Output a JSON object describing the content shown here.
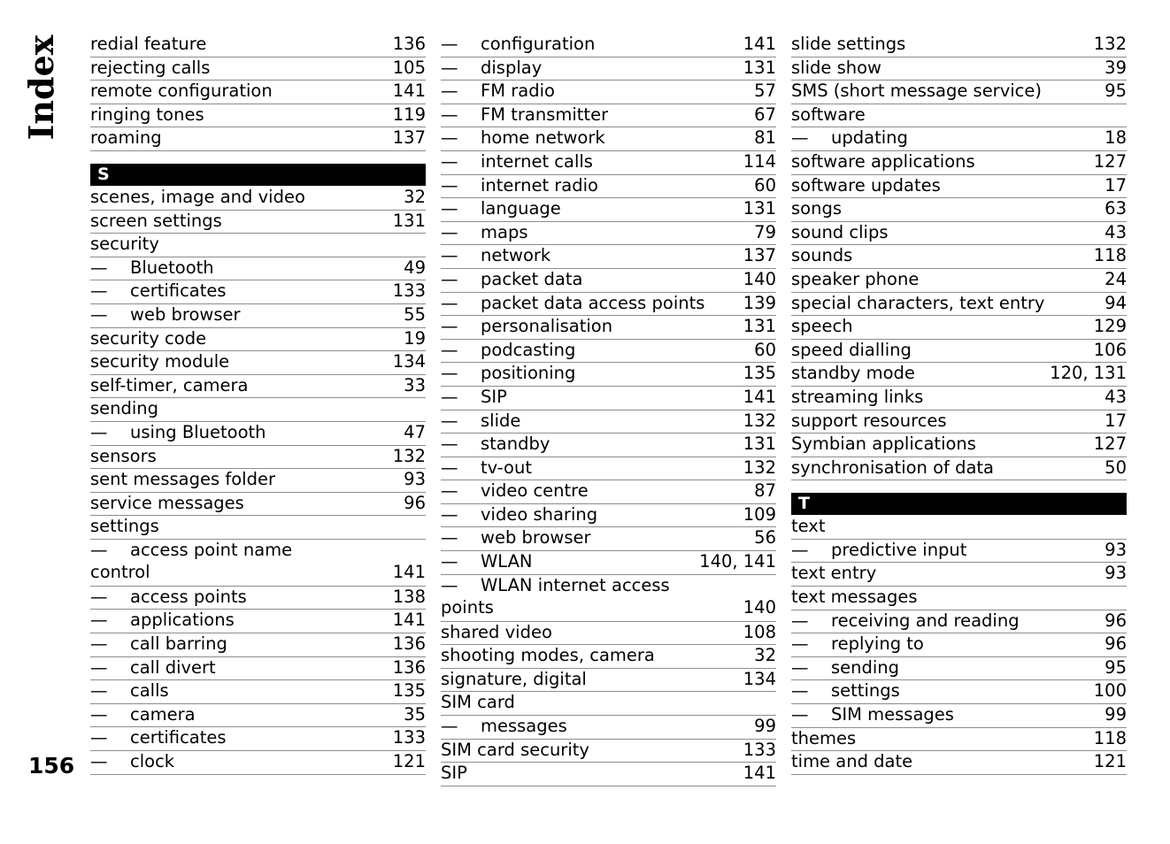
{
  "page": {
    "side_label": "Index",
    "folio": "156"
  },
  "columns": [
    {
      "id": "column-1",
      "blocks": [
        {
          "type": "entries",
          "rows": [
            {
              "term": "redial feature",
              "page": "136",
              "level": 1
            },
            {
              "term": "rejecting calls",
              "page": "105",
              "level": 1
            },
            {
              "term": "remote configuration",
              "page": "141",
              "level": 1
            },
            {
              "term": "ringing tones",
              "page": "119",
              "level": 1
            },
            {
              "term": "roaming",
              "page": "137",
              "level": 1
            }
          ]
        },
        {
          "type": "spacer"
        },
        {
          "type": "letter",
          "label": "S"
        },
        {
          "type": "entries",
          "rows": [
            {
              "term": "scenes, image and video",
              "page": "32",
              "level": 1
            },
            {
              "term": "screen settings",
              "page": "131",
              "level": 1
            },
            {
              "term": "security",
              "page": "",
              "level": 1
            },
            {
              "term": "Bluetooth",
              "page": "49",
              "level": 2
            },
            {
              "term": "certificates",
              "page": "133",
              "level": 2
            },
            {
              "term": "web browser",
              "page": "55",
              "level": 2
            },
            {
              "term": "security code",
              "page": "19",
              "level": 1
            },
            {
              "term": "security module",
              "page": "134",
              "level": 1
            },
            {
              "term": "self-timer, camera",
              "page": "33",
              "level": 1
            },
            {
              "term": "sending",
              "page": "",
              "level": 1
            },
            {
              "term": "using Bluetooth",
              "page": "47",
              "level": 2
            },
            {
              "term": "sensors",
              "page": "132",
              "level": 1
            },
            {
              "term": "sent messages folder",
              "page": "93",
              "level": 1
            },
            {
              "term": "service messages",
              "page": "96",
              "level": 1
            },
            {
              "term": "settings",
              "page": "",
              "level": 1
            },
            {
              "term": "access point name",
              "term_cont": "control",
              "page": "141",
              "level": 2,
              "wrapped": true
            },
            {
              "term": "access points",
              "page": "138",
              "level": 2
            },
            {
              "term": "applications",
              "page": "141",
              "level": 2
            },
            {
              "term": "call barring",
              "page": "136",
              "level": 2
            },
            {
              "term": "call divert",
              "page": "136",
              "level": 2
            },
            {
              "term": "calls",
              "page": "135",
              "level": 2
            },
            {
              "term": "camera",
              "page": "35",
              "level": 2
            },
            {
              "term": "certificates",
              "page": "133",
              "level": 2
            },
            {
              "term": "clock",
              "page": "121",
              "level": 2
            }
          ]
        }
      ]
    },
    {
      "id": "column-2",
      "blocks": [
        {
          "type": "entries",
          "rows": [
            {
              "term": "configuration",
              "page": "141",
              "level": 2
            },
            {
              "term": "display",
              "page": "131",
              "level": 2
            },
            {
              "term": "FM radio",
              "page": "57",
              "level": 2
            },
            {
              "term": "FM transmitter",
              "page": "67",
              "level": 2
            },
            {
              "term": "home network",
              "page": "81",
              "level": 2
            },
            {
              "term": "internet calls",
              "page": "114",
              "level": 2
            },
            {
              "term": "internet radio",
              "page": "60",
              "level": 2
            },
            {
              "term": "language",
              "page": "131",
              "level": 2
            },
            {
              "term": "maps",
              "page": "79",
              "level": 2
            },
            {
              "term": "network",
              "page": "137",
              "level": 2
            },
            {
              "term": "packet data",
              "page": "140",
              "level": 2
            },
            {
              "term": "packet data access points",
              "page": "139",
              "level": 2
            },
            {
              "term": "personalisation",
              "page": "131",
              "level": 2
            },
            {
              "term": "podcasting",
              "page": "60",
              "level": 2
            },
            {
              "term": "positioning",
              "page": "135",
              "level": 2
            },
            {
              "term": "SIP",
              "page": "141",
              "level": 2
            },
            {
              "term": "slide",
              "page": "132",
              "level": 2
            },
            {
              "term": "standby",
              "page": "131",
              "level": 2
            },
            {
              "term": "tv-out",
              "page": "132",
              "level": 2
            },
            {
              "term": "video centre",
              "page": "87",
              "level": 2
            },
            {
              "term": "video sharing",
              "page": "109",
              "level": 2
            },
            {
              "term": "web browser",
              "page": "56",
              "level": 2
            },
            {
              "term": "WLAN",
              "page": "140, 141",
              "level": 2
            },
            {
              "term": "WLAN internet access",
              "term_cont": "points",
              "page": "140",
              "level": 2,
              "wrapped": true
            },
            {
              "term": "shared video",
              "page": "108",
              "level": 1
            },
            {
              "term": "shooting modes, camera",
              "page": "32",
              "level": 1
            },
            {
              "term": "signature, digital",
              "page": "134",
              "level": 1
            },
            {
              "term": "SIM card",
              "page": "",
              "level": 1
            },
            {
              "term": "messages",
              "page": "99",
              "level": 2
            },
            {
              "term": "SIM card security",
              "page": "133",
              "level": 1
            },
            {
              "term": "SIP",
              "page": "141",
              "level": 1
            }
          ]
        }
      ]
    },
    {
      "id": "column-3",
      "blocks": [
        {
          "type": "entries",
          "rows": [
            {
              "term": "slide settings",
              "page": "132",
              "level": 1
            },
            {
              "term": "slide show",
              "page": "39",
              "level": 1
            },
            {
              "term": "SMS (short message service)",
              "page": "95",
              "level": 1
            },
            {
              "term": "software",
              "page": "",
              "level": 1
            },
            {
              "term": "updating",
              "page": "18",
              "level": 2
            },
            {
              "term": "software applications",
              "page": "127",
              "level": 1
            },
            {
              "term": "software updates",
              "page": "17",
              "level": 1
            },
            {
              "term": "songs",
              "page": "63",
              "level": 1
            },
            {
              "term": "sound clips",
              "page": "43",
              "level": 1
            },
            {
              "term": "sounds",
              "page": "118",
              "level": 1
            },
            {
              "term": "speaker phone",
              "page": "24",
              "level": 1
            },
            {
              "term": "special characters, text entry",
              "page": "94",
              "level": 1
            },
            {
              "term": "speech",
              "page": "129",
              "level": 1
            },
            {
              "term": "speed dialling",
              "page": "106",
              "level": 1
            },
            {
              "term": "standby mode",
              "page": "120, 131",
              "level": 1
            },
            {
              "term": "streaming links",
              "page": "43",
              "level": 1
            },
            {
              "term": "support resources",
              "page": "17",
              "level": 1
            },
            {
              "term": "Symbian applications",
              "page": "127",
              "level": 1
            },
            {
              "term": "synchronisation of data",
              "page": "50",
              "level": 1
            }
          ]
        },
        {
          "type": "spacer"
        },
        {
          "type": "letter",
          "label": "T"
        },
        {
          "type": "entries",
          "rows": [
            {
              "term": "text",
              "page": "",
              "level": 1
            },
            {
              "term": "predictive input",
              "page": "93",
              "level": 2
            },
            {
              "term": "text entry",
              "page": "93",
              "level": 1
            },
            {
              "term": "text messages",
              "page": "",
              "level": 1
            },
            {
              "term": "receiving and reading",
              "page": "96",
              "level": 2
            },
            {
              "term": "replying to",
              "page": "96",
              "level": 2
            },
            {
              "term": "sending",
              "page": "95",
              "level": 2
            },
            {
              "term": "settings",
              "page": "100",
              "level": 2
            },
            {
              "term": "SIM messages",
              "page": "99",
              "level": 2
            },
            {
              "term": "themes",
              "page": "118",
              "level": 1
            },
            {
              "term": "time and date",
              "page": "121",
              "level": 1
            }
          ]
        }
      ]
    }
  ],
  "glyphs": {
    "em_dash": "—"
  }
}
